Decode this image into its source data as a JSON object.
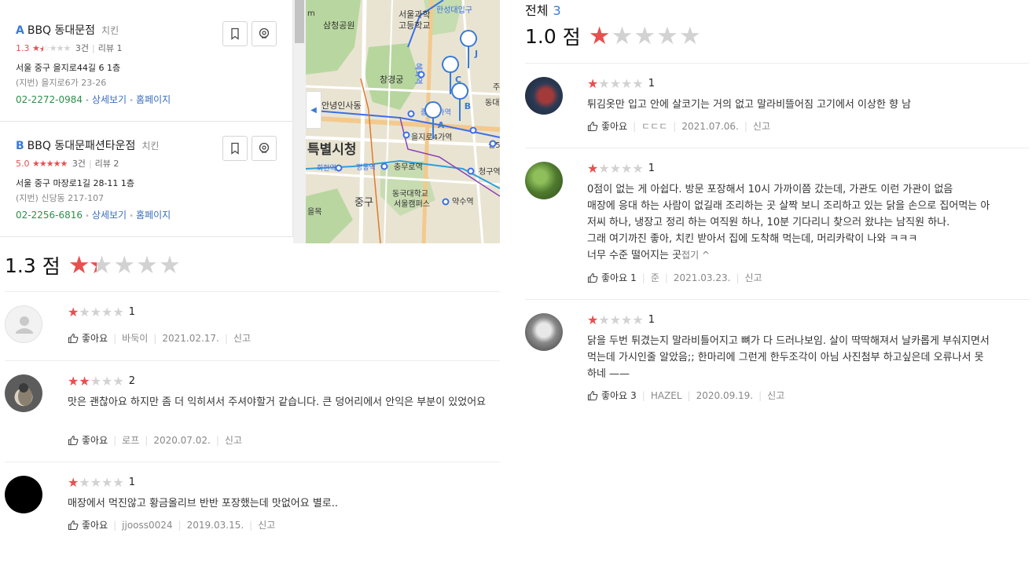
{
  "places": [
    {
      "letter": "A",
      "name": "BBQ 동대문점",
      "category": "치킨",
      "score": "1.3",
      "rating_stars": 1.3,
      "rating_count": "3건",
      "review_label": "리뷰 1",
      "address": "서울 중구 을지로44길 6 1층",
      "lot_address": "(지번) 을지로6가 23-26",
      "phone": "02-2272-0984",
      "detail_link": "상세보기",
      "homepage_link": "홈페이지"
    },
    {
      "letter": "B",
      "name": "BBQ 동대문패션타운점",
      "category": "치킨",
      "score": "5.0",
      "rating_stars": 5,
      "rating_count": "3건",
      "review_label": "리뷰 2",
      "address": "서울 중구 마장로1길 28-11 1층",
      "lot_address": "(지번) 신당동 217-107",
      "phone": "02-2256-6816",
      "detail_link": "상세보기",
      "homepage_link": "홈페이지"
    }
  ],
  "map": {
    "labels": [
      "삼청공원",
      "서울과학",
      "고등학교",
      "창경궁",
      "한성대입구",
      "혜화역",
      "안녕인사동",
      "종로5가역",
      "을지로4가역",
      "특별시청",
      "동대",
      "신5",
      "회현역",
      "명동역",
      "충무로역",
      "청구역",
      "동국대학교",
      "서울캠퍼스",
      "중구",
      "약수역",
      "을목",
      "주",
      "m"
    ],
    "markers": [
      "A",
      "B",
      "C",
      "J"
    ]
  },
  "left_summary": {
    "score": "1.3",
    "unit": "점",
    "stars": 1.3
  },
  "left_reviews": [
    {
      "stars": 1,
      "score_text": "1",
      "text": "",
      "like_label": "좋아요",
      "like_count": "",
      "author": "바둑이",
      "date": "2021.02.17.",
      "report": "신고"
    },
    {
      "stars": 2,
      "score_text": "2",
      "text": "맛은 괜찮아요 하지만 좀 더 익히셔서 주셔야할거 같습니다. 큰 덩어리에서 안익은 부분이 있었어요",
      "like_label": "좋아요",
      "like_count": "",
      "author": "로프",
      "date": "2020.07.02.",
      "report": "신고"
    },
    {
      "stars": 1,
      "score_text": "1",
      "text": "매장에서 먹진않고 황금올리브 반반 포장했는데  맛없어요 별로..",
      "like_label": "좋아요",
      "like_count": "",
      "author": "jjooss0024",
      "date": "2019.03.15.",
      "report": "신고"
    }
  ],
  "right_header": {
    "title": "전체",
    "count": "3"
  },
  "right_summary": {
    "score": "1.0",
    "unit": "점",
    "stars": 1
  },
  "right_reviews": [
    {
      "stars": 1,
      "score_text": "1",
      "lines": [
        "튀김옷만 입고 안에 살코기는 거의 없고 말라비뜰어짐 고기에서 이상한 향 남"
      ],
      "fold": "",
      "like_label": "좋아요",
      "like_count": "",
      "author": "ㄷㄷㄷ",
      "date": "2021.07.06.",
      "report": "신고"
    },
    {
      "stars": 1,
      "score_text": "1",
      "lines": [
        "0점이 없는 게 아쉽다. 방문 포장해서 10시 가까이쯤 갔는데, 가관도 이런 가관이 없음",
        "매장에 응대 하는 사람이 없길래 조리하는 곳 살짝 보니 조리하고 있는 닭을 손으로 집어먹는 아",
        "저씨 하나, 냉장고 정리 하는 여직원 하나, 10분 기다리니 찾으러 왔냐는 남직원 하나.",
        "그래 여기까진 좋아, 치킨 받아서 집에 도착해 먹는데, 머리카락이 나와 ㅋㅋㅋ",
        "너무 수준 떨어지는 곳"
      ],
      "fold": "접기 ^",
      "like_label": "좋아요",
      "like_count": "1",
      "author": "준",
      "date": "2021.03.23.",
      "report": "신고"
    },
    {
      "stars": 1,
      "score_text": "1",
      "lines": [
        "닭을 두번 튀겼는지 말라비틀어지고 뼈가 다 드러나보임. 살이 딱딱해져서 날카롭게 부숴지면서",
        "먹는데 가시인줄 알았음;; 한마리에 그런게 한두조각이 아님 사진첨부 하고싶은데 오류나서 못",
        "하네 ——"
      ],
      "fold": "",
      "like_label": "좋아요",
      "like_count": "3",
      "author": "HAZEL",
      "date": "2020.09.19.",
      "report": "신고"
    }
  ],
  "colors": {
    "star_active": "#e84f4f",
    "star_inactive": "#d2d2d2",
    "accent_blue": "#3a7bd5",
    "phone_green": "#2e8f4b"
  }
}
